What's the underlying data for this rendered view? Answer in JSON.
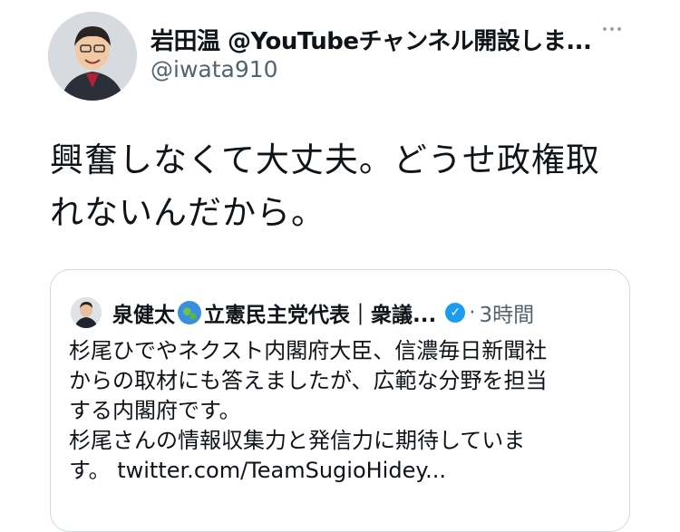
{
  "tweet": {
    "author_name": "岩田温 @YouTubeチャンネル開設しま...",
    "handle": "@iwata910",
    "body_lines": [
      "興奮しなくて大丈夫。どうせ政権取",
      "れないんだから。"
    ]
  },
  "quote": {
    "author_name_part1": "泉健太",
    "author_name_part2": "立憲民主党代表｜衆議...",
    "time": "3時間",
    "dot": "·",
    "text_lines": [
      "杉尾ひでやネクスト内閣府大臣、信濃毎日新聞社",
      "からの取材にも答えましたが、広範な分野を担当",
      "する内閣府です。",
      "杉尾さんの情報収集力と発信力に期待していま",
      "す。 twitter.com/TeamSugioHidey..."
    ]
  },
  "icons": {
    "more": "more-horizontal-icon",
    "globe": "globe-emoji-icon",
    "verified": "verified-badge-icon"
  },
  "colors": {
    "text_primary": "#0f1419",
    "text_secondary": "#536471",
    "border": "#cfd9de",
    "verified": "#1d9bf0"
  }
}
